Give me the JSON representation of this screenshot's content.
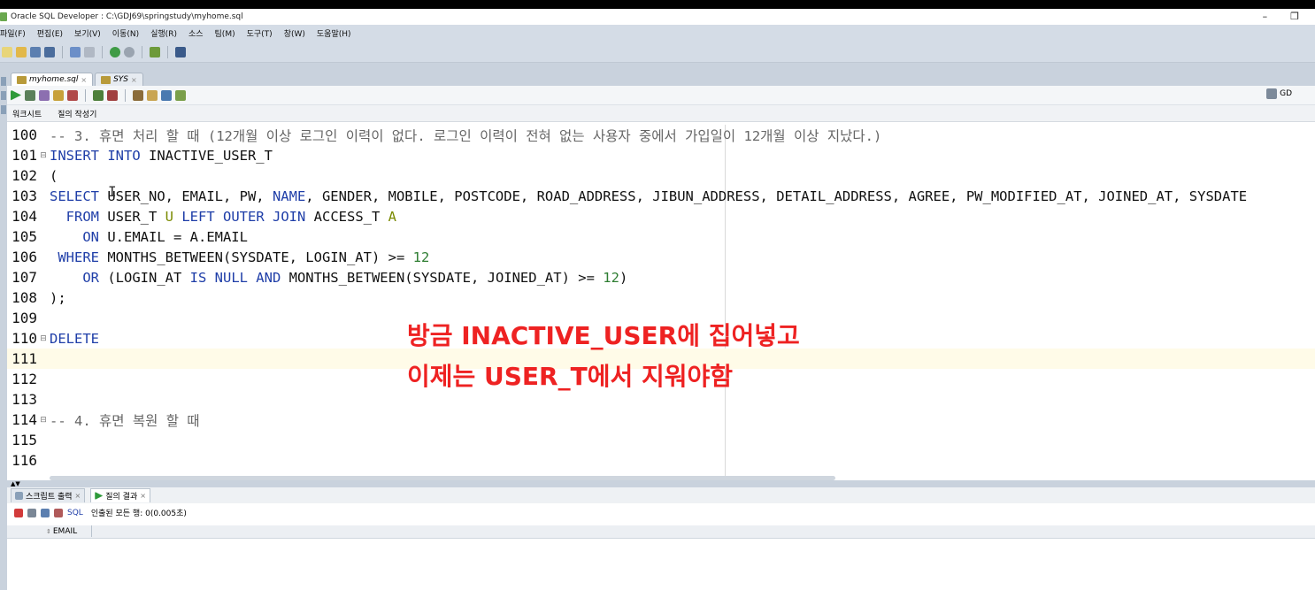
{
  "window": {
    "title": "Oracle SQL Developer : C:\\GDJ69\\springstudy\\myhome.sql",
    "minimize": "–",
    "restore": "❐"
  },
  "menu": [
    "파일(F)",
    "편집(E)",
    "보기(V)",
    "이동(N)",
    "실행(R)",
    "소스",
    "팀(M)",
    "도구(T)",
    "창(W)",
    "도움말(H)"
  ],
  "doc_tabs": [
    {
      "label": "myhome.sql",
      "active": true
    },
    {
      "label": "SYS",
      "active": false
    }
  ],
  "connection": "GD",
  "sub_tabs": [
    "워크시트",
    "질의 작성기"
  ],
  "editor_lines": [
    {
      "num": "100",
      "fold": "",
      "html": "<span class=\"cm\">-- 3. 휴면 처리 할 때 (12개월 이상 로그인 이력이 없다. 로그인 이력이 전혀 없는 사용자 중에서 가입일이 12개월 이상 지났다.)</span>"
    },
    {
      "num": "101",
      "fold": "⊟",
      "html": "<span class=\"kw\">INSERT INTO</span> INACTIVE_USER_T"
    },
    {
      "num": "102",
      "fold": "",
      "html": "("
    },
    {
      "num": "103",
      "fold": "",
      "html": "<span class=\"kw\">SELECT</span> USER_NO, EMAIL, PW, <span class=\"kw\">NAME</span>, GENDER, MOBILE, POSTCODE, ROAD_ADDRESS, JIBUN_ADDRESS, DETAIL_ADDRESS, AGREE, PW_MODIFIED_AT, JOINED_AT, SYSDATE"
    },
    {
      "num": "104",
      "fold": "",
      "html": "  <span class=\"kw\">FROM</span> USER_T <span class=\"id\">U</span> <span class=\"kw\">LEFT OUTER JOIN</span> ACCESS_T <span class=\"id\">A</span>"
    },
    {
      "num": "105",
      "fold": "",
      "html": "    <span class=\"kw\">ON</span> U.EMAIL = A.EMAIL"
    },
    {
      "num": "106",
      "fold": "",
      "html": " <span class=\"kw\">WHERE</span> MONTHS_BETWEEN(SYSDATE, LOGIN_AT) &gt;= <span class=\"num\">12</span>"
    },
    {
      "num": "107",
      "fold": "",
      "html": "    <span class=\"kw\">OR</span> (LOGIN_AT <span class=\"kw\">IS NULL AND</span> MONTHS_BETWEEN(SYSDATE, JOINED_AT) &gt;= <span class=\"num\">12</span>)"
    },
    {
      "num": "108",
      "fold": "",
      "html": ");"
    },
    {
      "num": "109",
      "fold": "",
      "html": ""
    },
    {
      "num": "110",
      "fold": "⊟",
      "html": "<span class=\"kw\">DELETE</span>"
    },
    {
      "num": "111",
      "fold": "",
      "html": "",
      "highlight": true
    },
    {
      "num": "112",
      "fold": "",
      "html": ""
    },
    {
      "num": "113",
      "fold": "",
      "html": ""
    },
    {
      "num": "114",
      "fold": "⊟",
      "html": "<span class=\"cm\">-- 4. 휴면 복원 할 때</span>"
    },
    {
      "num": "115",
      "fold": "",
      "html": ""
    },
    {
      "num": "116",
      "fold": "",
      "html": ""
    }
  ],
  "annotation": {
    "line1": "방금 INACTIVE_USER에 집어넣고",
    "line2": "이제는 USER_T에서 지워야함"
  },
  "bottom_tabs": [
    {
      "label": "스크립트 출력",
      "active": false
    },
    {
      "label": "질의 결과",
      "active": true
    }
  ],
  "results": {
    "sql_label": "SQL",
    "status": "인출된 모든 행: 0(0.005초)",
    "columns": [
      "EMAIL"
    ]
  },
  "colors": {
    "keyword": "#1f3ea8",
    "comment": "#666666",
    "number": "#2e7d32",
    "annotation": "#ee2222",
    "chrome": "#d4dce6"
  }
}
